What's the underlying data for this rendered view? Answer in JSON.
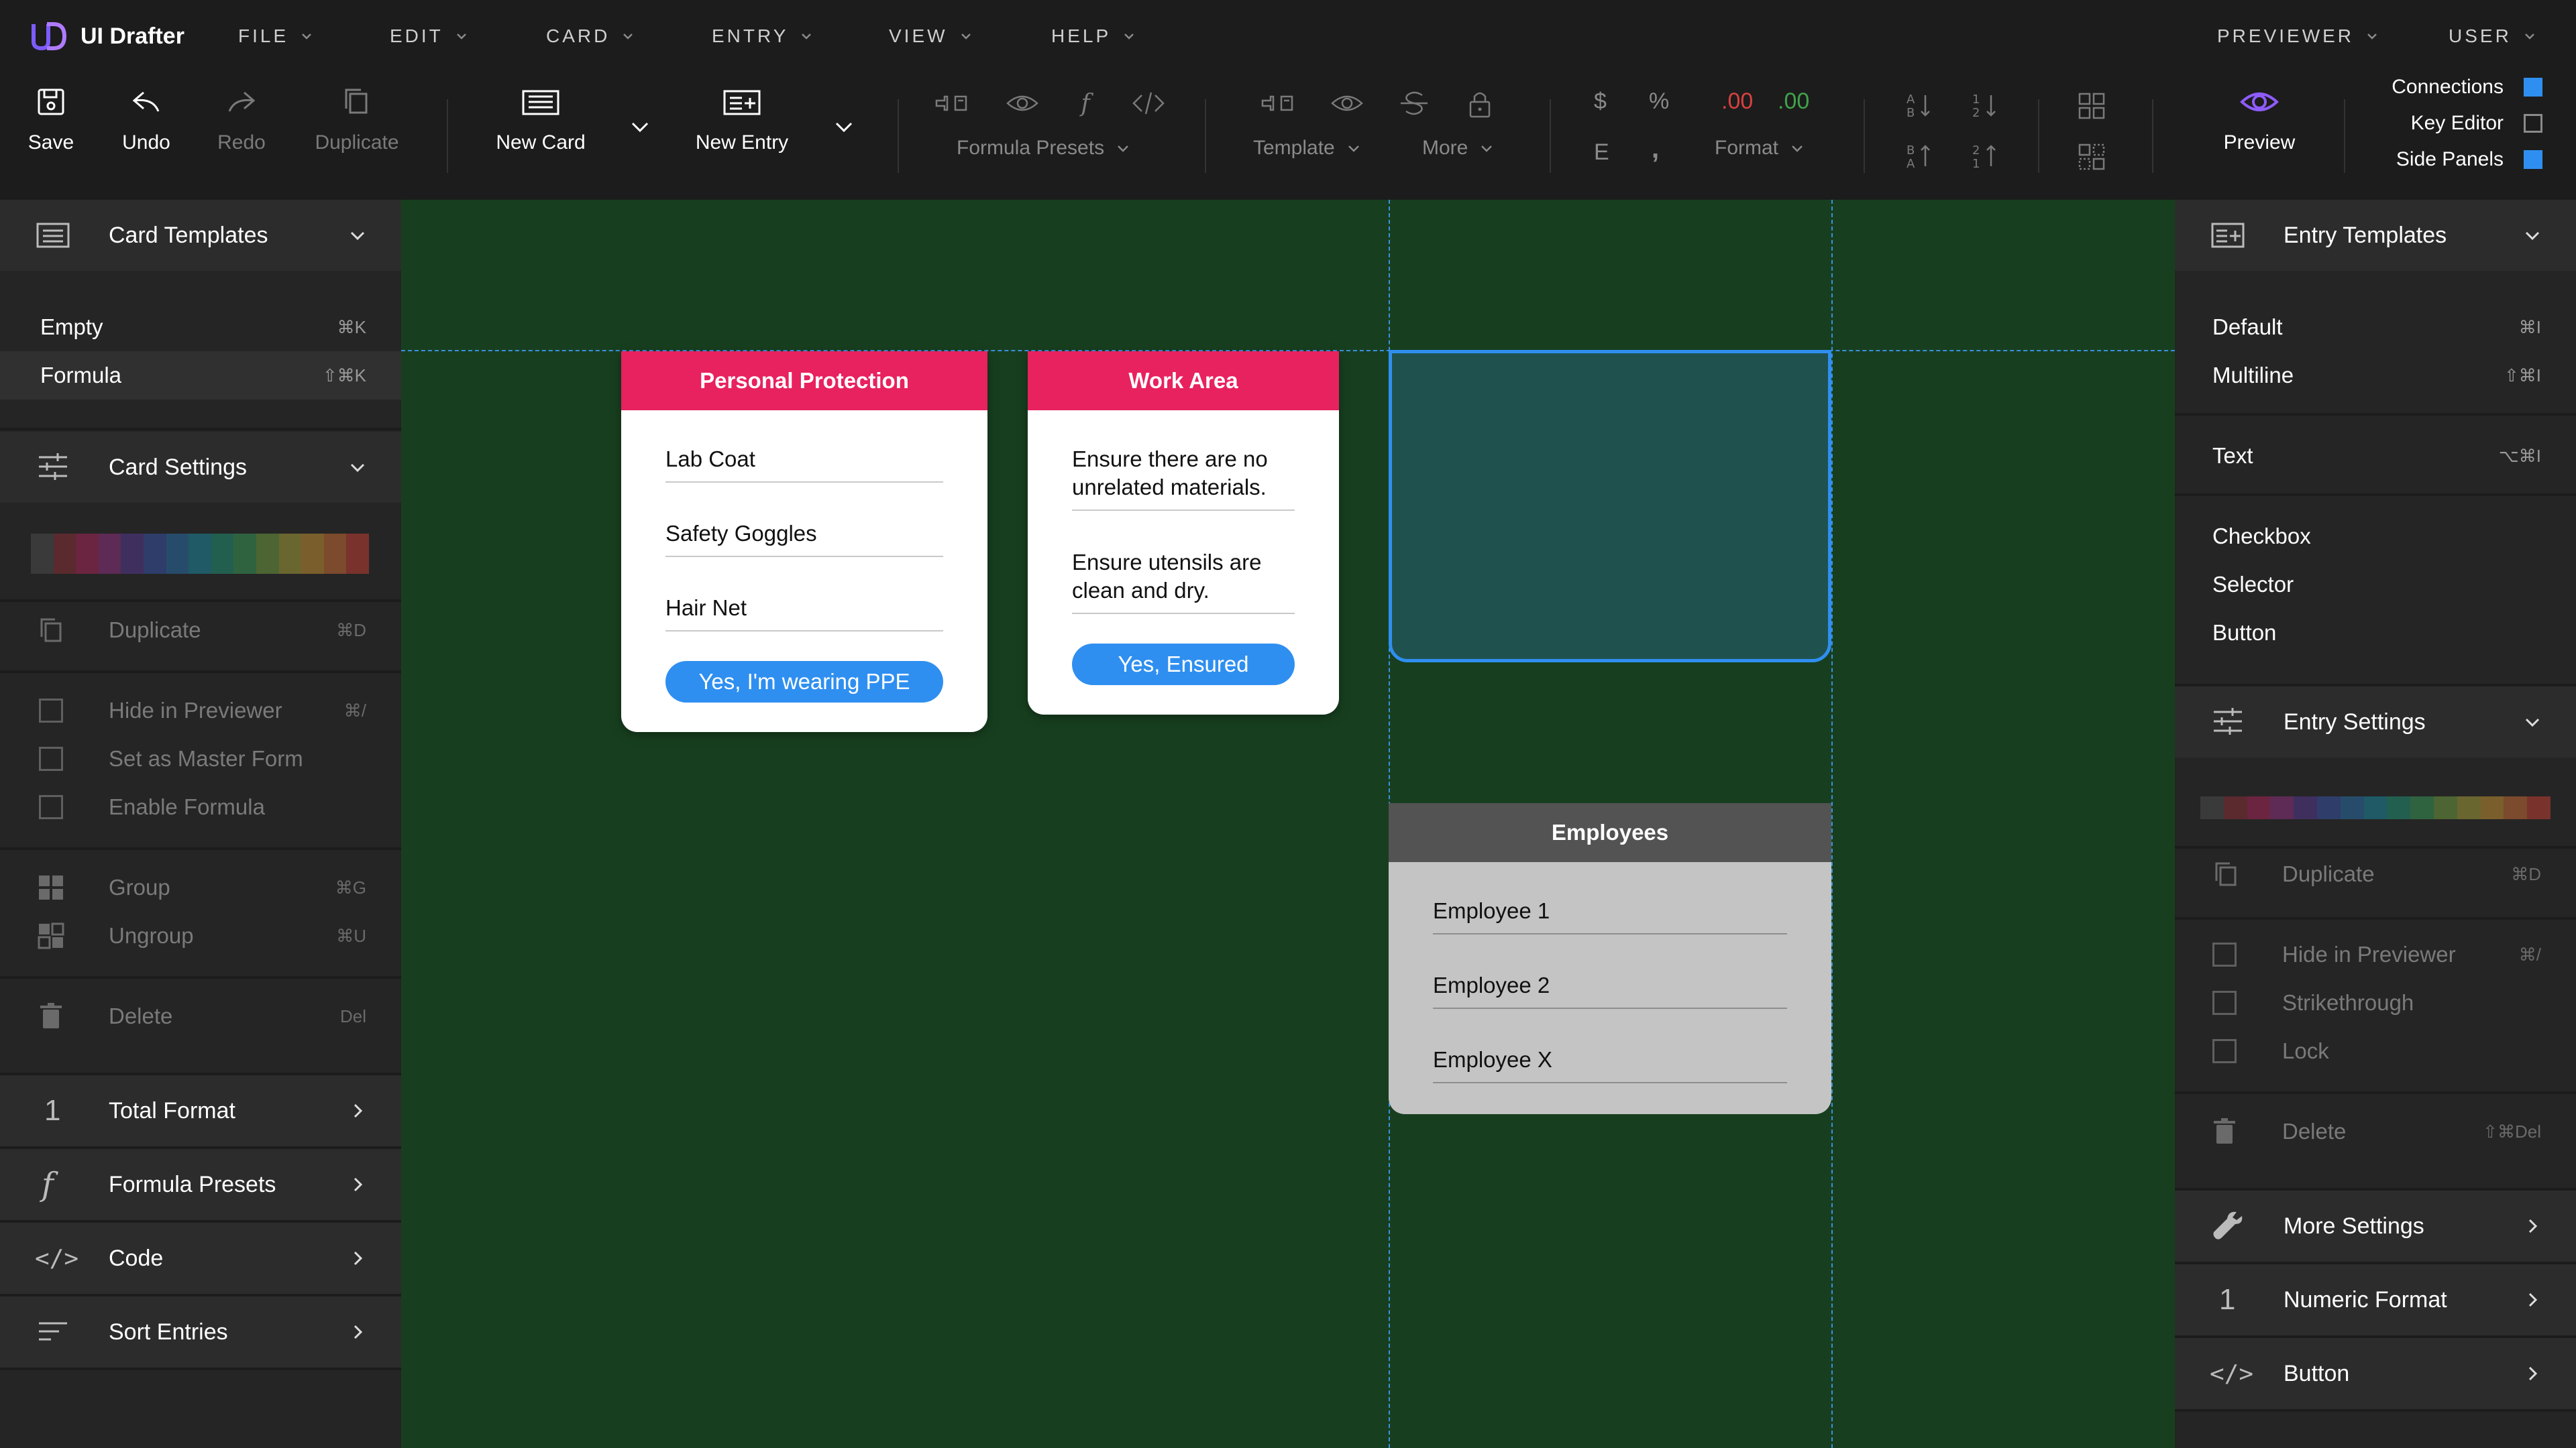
{
  "app": {
    "title": "UI Drafter",
    "logo_text": "UD"
  },
  "menu": {
    "items": [
      {
        "key": "file",
        "label": "FILE"
      },
      {
        "key": "edit",
        "label": "EDIT"
      },
      {
        "key": "card",
        "label": "CARD"
      },
      {
        "key": "entry",
        "label": "ENTRY"
      },
      {
        "key": "view",
        "label": "VIEW"
      },
      {
        "key": "help",
        "label": "HELP"
      }
    ],
    "right": [
      {
        "key": "previewer",
        "label": "PREVIEWER"
      },
      {
        "key": "user",
        "label": "USER"
      }
    ]
  },
  "toolbar": {
    "save": "Save",
    "undo": "Undo",
    "redo": "Redo",
    "duplicate": "Duplicate",
    "new_card": "New Card",
    "new_entry": "New Entry",
    "formula_presets": "Formula Presets",
    "template": "Template",
    "more": "More",
    "format": "Format",
    "format_dec_red": ".00",
    "format_dec_green": ".00",
    "symbol_dollar": "$",
    "symbol_percent": "%",
    "symbol_e": "E",
    "symbol_comma": ",",
    "preview": "Preview",
    "toggles": [
      {
        "label": "Connections",
        "on": true
      },
      {
        "label": "Key Editor",
        "on": false
      },
      {
        "label": "Side Panels",
        "on": true
      }
    ]
  },
  "left_panel": {
    "card_templates": {
      "title": "Card Templates",
      "items": [
        {
          "label": "Empty",
          "shortcut": "⌘K"
        },
        {
          "label": "Formula",
          "shortcut": "⇧⌘K"
        }
      ]
    },
    "card_settings": {
      "title": "Card Settings"
    },
    "duplicate": {
      "label": "Duplicate",
      "shortcut": "⌘D"
    },
    "checks": [
      {
        "label": "Hide in Previewer",
        "shortcut": "⌘/"
      },
      {
        "label": "Set as Master Form",
        "shortcut": ""
      },
      {
        "label": "Enable Formula",
        "shortcut": ""
      }
    ],
    "group": {
      "label": "Group",
      "shortcut": "⌘G"
    },
    "ungroup": {
      "label": "Ungroup",
      "shortcut": "⌘U"
    },
    "delete": {
      "label": "Delete",
      "shortcut": "Del"
    },
    "links": [
      {
        "label": "Total Format",
        "icon_text": "1"
      },
      {
        "label": "Formula Presets",
        "icon_text": "f"
      },
      {
        "label": "Code",
        "icon_text": "</>"
      },
      {
        "label": "Sort Entries",
        "icon_text": ""
      }
    ]
  },
  "right_panel": {
    "entry_templates": {
      "title": "Entry Templates",
      "items": [
        {
          "label": "Default",
          "shortcut": "⌘I"
        },
        {
          "label": "Multiline",
          "shortcut": "⇧⌘I"
        },
        {
          "label": "Text",
          "shortcut": "⌥⌘I"
        },
        {
          "label": "Checkbox",
          "shortcut": ""
        },
        {
          "label": "Selector",
          "shortcut": ""
        },
        {
          "label": "Button",
          "shortcut": ""
        }
      ]
    },
    "entry_settings": {
      "title": "Entry Settings"
    },
    "duplicate": {
      "label": "Duplicate",
      "shortcut": "⌘D"
    },
    "checks": [
      {
        "label": "Hide in Previewer",
        "shortcut": "⌘/"
      },
      {
        "label": "Strikethrough",
        "shortcut": ""
      },
      {
        "label": "Lock",
        "shortcut": ""
      }
    ],
    "delete": {
      "label": "Delete",
      "shortcut": "⇧⌘Del"
    },
    "links": [
      {
        "label": "More Settings",
        "icon_text": ""
      },
      {
        "label": "Numeric Format",
        "icon_text": "1"
      },
      {
        "label": "Button",
        "icon_text": "</>"
      }
    ]
  },
  "colors": {
    "swatches": [
      "#3a3a3a",
      "#5a2a2f",
      "#6b2540",
      "#5d2b55",
      "#3f2f5f",
      "#2f3d6a",
      "#274c6b",
      "#1f5a66",
      "#235f4f",
      "#2f6340",
      "#4d6532",
      "#6a6630",
      "#7a5f2c",
      "#7c4a2c",
      "#7a322c"
    ],
    "accent_pink": "#e8215f",
    "accent_blue": "#2f8ff0",
    "canvas_green": "#173f1f"
  },
  "canvas": {
    "cards": [
      {
        "title": "Personal Protection",
        "entries": [
          "Lab Coat",
          "Safety Goggles",
          "Hair Net"
        ],
        "button": "Yes, I'm wearing PPE"
      },
      {
        "title": "Work Area",
        "entries": [
          "Ensure there are no unrelated materials.",
          "Ensure utensils are clean and dry."
        ],
        "button": "Yes, Ensured"
      },
      {
        "title": "Employees",
        "entries": [
          "Employee 1",
          "Employee 2",
          "Employee X"
        ]
      }
    ]
  }
}
